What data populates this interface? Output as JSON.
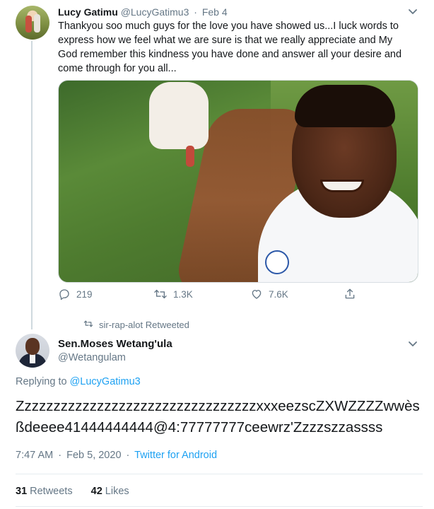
{
  "parent_tweet": {
    "name": "Lucy Gatimu",
    "handle": "@LucyGatimu3",
    "separator": "·",
    "date": "Feb 4",
    "text": "Thankyou soo much guys for the love you have showed us...I luck words to express how we feel what we are sure is that we really appreciate  and My God remember this kindness you have done and answer all your desire and come through for you all...",
    "actions": {
      "replies": "219",
      "retweets": "1.3K",
      "likes": "7.6K"
    }
  },
  "retweet_context": {
    "label": "sir-rap-alot Retweeted"
  },
  "main_tweet": {
    "name": "Sen.Moses Wetang'ula",
    "handle": "@Wetangulam",
    "replying_prefix": "Replying to",
    "replying_to": "@LucyGatimu3",
    "text": "ZzzzzzzzzzzzzzzzzzzzzzzzzzzzzzzzzxxxeezscZXWZZZZwwèsßdeeee41444444444@4:77777777ceewrz'Zzzzszzassss",
    "time": "7:47 AM",
    "separator": "·",
    "date": "Feb 5, 2020",
    "source": "Twitter for Android",
    "retweets_count": "31",
    "retweets_label": "Retweets",
    "likes_count": "42",
    "likes_label": "Likes"
  },
  "icons": {
    "reply": "reply-icon",
    "retweet": "retweet-icon",
    "like": "heart-icon",
    "share": "share-icon",
    "more": "chevron-down-icon"
  },
  "colors": {
    "accent": "#1da1f2",
    "secondary_text": "#657786",
    "primary_text": "#14171a"
  }
}
